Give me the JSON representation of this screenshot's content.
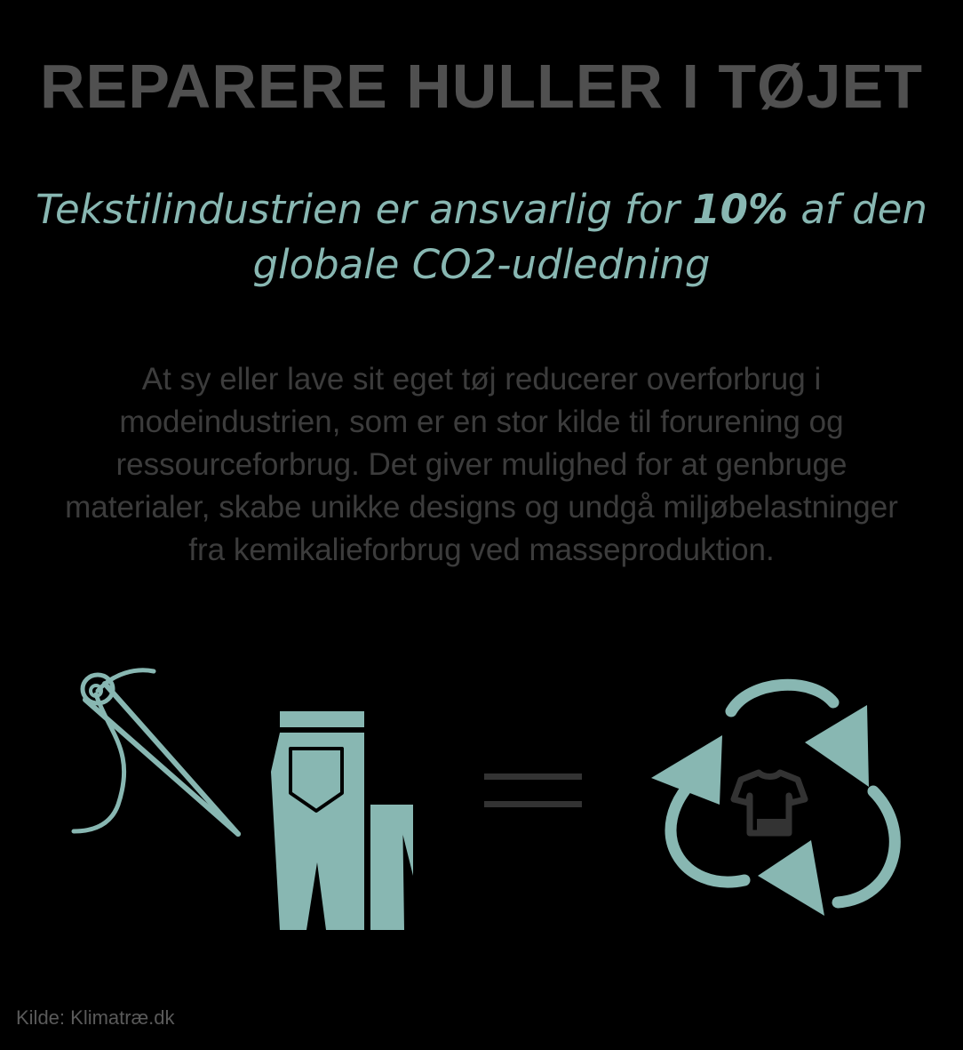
{
  "title": "REPARERE HULLER I TØJET",
  "subtitle": {
    "before": "Tekstilindustrien er ansvarlig for ",
    "highlight": "10%",
    "after": " af den globale CO2-udledning"
  },
  "body": "At sy eller lave sit eget tøj reducerer overforbrug i modeindustrien, som er en stor kilde til forurening og ressourceforbrug. Det giver mulighed for at genbruge materialer, skabe unikke designs og undgå miljøbelastninger fra kemikalieforbrug ved masseproduktion.",
  "source": "Kilde: Klimatræ.dk",
  "icons": [
    "needle-thread-icon",
    "jeans-icon",
    "equals-icon",
    "recycle-shirt-icon"
  ],
  "colors": {
    "background": "#000000",
    "title": "#505050",
    "accent": "#88b7b2",
    "body": "#3c3c3c",
    "source": "#5a5a5a",
    "icon_dark": "#333333"
  }
}
